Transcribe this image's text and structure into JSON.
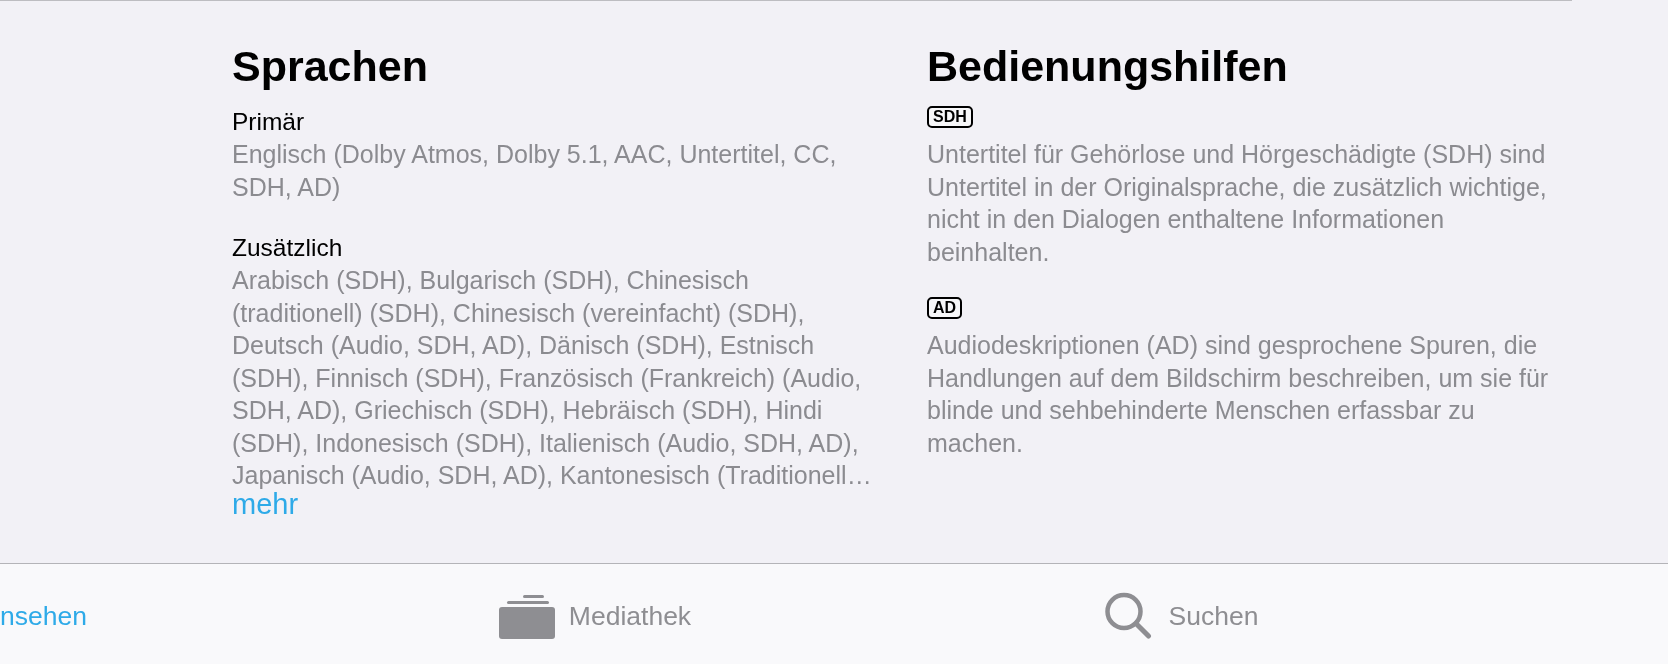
{
  "languages": {
    "title": "Sprachen",
    "groups": [
      {
        "label": "Primär",
        "text": "Englisch (Dolby Atmos, Dolby 5.1, AAC, Untertitel, CC, SDH, AD)"
      },
      {
        "label": "Zusätzlich",
        "text": "Arabisch (SDH), Bulgarisch (SDH), Chinesisch (traditionell) (SDH), Chinesisch (vereinfacht) (SDH), Deutsch (Audio, SDH, AD), Dänisch (SDH), Estnisch (SDH), Finnisch (SDH), Französisch (Frankreich) (Audio, SDH, AD), Griechisch (SDH), Hebräisch (SDH), Hindi (SDH), Indonesisch (SDH), Italienisch (Audio, SDH, AD), Japanisch (Audio, SDH, AD), Kantonesisch (Traditionell…"
      }
    ],
    "more_link": "mehr"
  },
  "accessibility": {
    "title": "Bedienungshilfen",
    "items": [
      {
        "badge": "SDH",
        "text": "Untertitel für Gehörlose und Hörgeschädigte (SDH) sind Untertitel in der Originalsprache, die zusätzlich wichtige, nicht in den Dialogen enthaltene Informationen beinhalten."
      },
      {
        "badge": "AD",
        "text": "Audiodeskriptionen (AD) sind gesprochene Spuren, die Handlungen auf dem Bildschirm beschreiben, um sie für blinde und sehbehinderte Menschen erfassbar zu machen."
      }
    ]
  },
  "tab_bar": {
    "tabs": [
      {
        "label": "nsehen",
        "kind": "plain",
        "selected": true
      },
      {
        "label": "Mediathek",
        "kind": "library",
        "selected": false
      },
      {
        "label": "Suchen",
        "kind": "search",
        "selected": false
      }
    ]
  }
}
